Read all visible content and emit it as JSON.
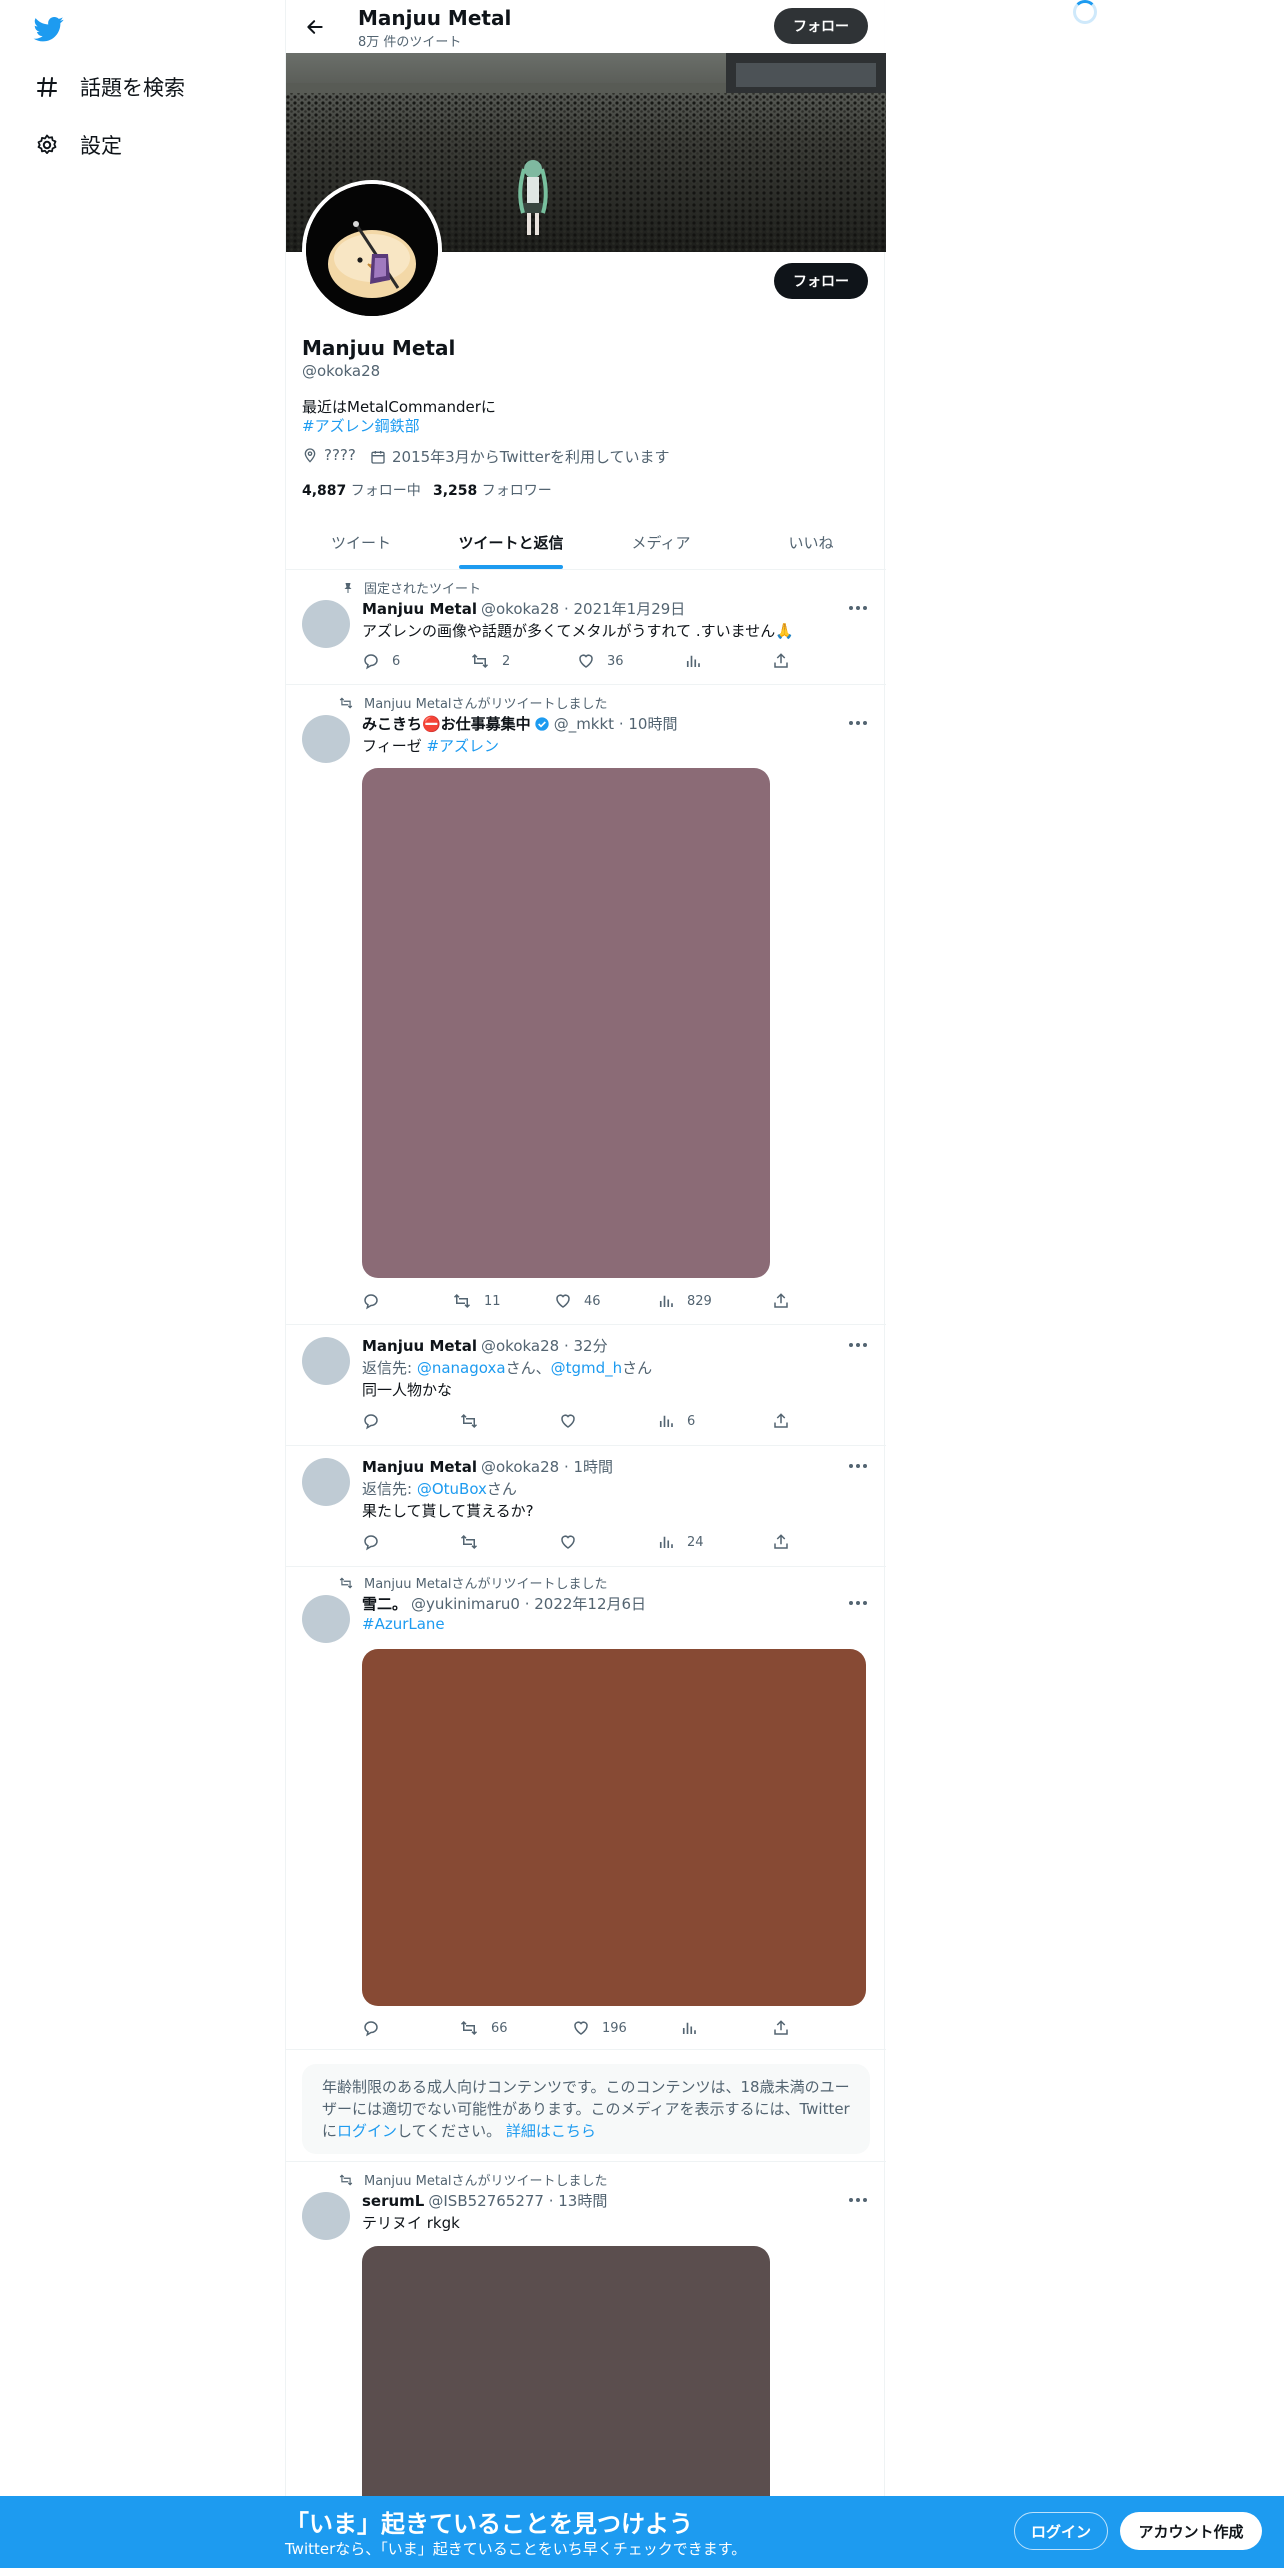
{
  "sidebar": {
    "items": [
      {
        "label": "話題を検索",
        "icon": "hashtag-icon"
      },
      {
        "label": "設定",
        "icon": "gear-icon"
      }
    ]
  },
  "header": {
    "title": "Manjuu Metal",
    "subtitle": "8万 件のツイート",
    "follow": "フォロー"
  },
  "profile": {
    "follow": "フォロー",
    "name": "Manjuu Metal",
    "handle": "@okoka28",
    "bio_line1": "最近はMetalCommanderに",
    "bio_hashtag": "#アズレン鋼鉄部",
    "location": "????",
    "joined": "2015年3月からTwitterを利用しています",
    "following_count": "4,887",
    "following_label": "フォロー中",
    "followers_count": "3,258",
    "followers_label": "フォロワー"
  },
  "tabs": [
    "ツイート",
    "ツイートと返信",
    "メディア",
    "いいね"
  ],
  "tweets": [
    {
      "context": "固定されたツイート",
      "name": "Manjuu Metal",
      "meta": "@okoka28 · 2021年1月29日",
      "text": "アズレンの画像や話題が多くてメタルがうすれて .すいません🙏",
      "replies": "6",
      "retweets": "2",
      "likes": "36",
      "views": ""
    },
    {
      "context": "Manjuu Metalさんがリツイートしました",
      "name": "みこきち⛔お仕事募集中",
      "meta": "@_mkkt · 10時間",
      "text": "フィーゼ",
      "hashtag": "#アズレン",
      "media_color": "#8b6b76",
      "replies": "",
      "retweets": "11",
      "likes": "46",
      "views": "829"
    },
    {
      "name": "Manjuu Metal",
      "meta": "@okoka28 · 32分",
      "reply_prefix": "返信先:",
      "reply_user1": "@nanagoxa",
      "reply_mid": "さん、",
      "reply_user2": "@tgmd_h",
      "reply_suffix": "さん",
      "text": "同一人物かな",
      "replies": "",
      "retweets": "",
      "likes": "",
      "views": "6"
    },
    {
      "name": "Manjuu Metal",
      "meta": "@okoka28 · 1時間",
      "reply_prefix": "返信先:",
      "reply_user1": "@OtuBox",
      "reply_suffix": "さん",
      "text": "果たして貰して貰えるか?",
      "replies": "",
      "retweets": "",
      "likes": "",
      "views": "24"
    },
    {
      "context": "Manjuu Metalさんがリツイートしました",
      "name": "雪二。",
      "meta": "@yukinimaru0 · 2022年12月6日",
      "hashtag": "#AzurLane",
      "media_color": "#874a34",
      "replies": "",
      "retweets": "66",
      "likes": "196",
      "views": ""
    },
    {
      "context": "Manjuu Metalさんがリツイートしました",
      "name": "serumL",
      "meta": "@ISB52765277 · 13時間",
      "text": "テリヌイ rkgk",
      "media_color": "#5b4e4e"
    }
  ],
  "notice": {
    "text1": "年齢制限のある成人向けコンテンツです。このコンテンツは、18歳未満のユーザーには適切でない可能性があります。このメディアを表示するには、Twitter",
    "text2": "に",
    "login": "ログイン",
    "text3": "してください。",
    "details": "詳細はこちら"
  },
  "bottom_bar": {
    "title": "「いま」起きていることを見つけよう",
    "subtitle": "Twitterなら、「いま」起きていることをいち早くチェックできます。",
    "login": "ログイン",
    "signup": "アカウント作成"
  },
  "colors": {
    "accent": "#1d9bf0",
    "dark": "#0f1419",
    "muted": "#536471"
  }
}
